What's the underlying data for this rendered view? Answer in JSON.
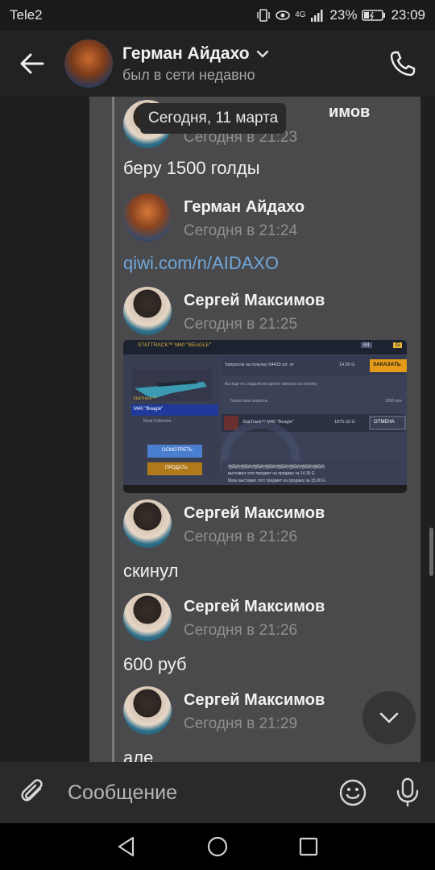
{
  "status_bar": {
    "carrier": "Tele2",
    "signal_label": "4G",
    "battery": "23%",
    "time": "23:09"
  },
  "header": {
    "title": "Герман Айдахо",
    "subtitle": "был в сети недавно"
  },
  "date_tooltip": "Сегодня, 11 марта",
  "messages": [
    {
      "author": "Сергей Максимов",
      "author_visible": "имов",
      "time": "Сегодня в 21:23",
      "text": "беру 1500 голды"
    },
    {
      "author": "Герман Айдахо",
      "time": "Сегодня в 21:24",
      "text": "qiwi.com/n/AIDAXO"
    },
    {
      "author": "Сергей Максимов",
      "time": "Сегодня в 21:25"
    },
    {
      "author": "Сергей Максимов",
      "time": "Сегодня в 21:26",
      "text": "скинул"
    },
    {
      "author": "Сергей Максимов",
      "time": "Сегодня в 21:26",
      "text": "600 руб"
    },
    {
      "author": "Сергей Максимов",
      "time": "Сегодня в 21:29",
      "text": "але"
    }
  ],
  "screenshot": {
    "item_title": "STATTRACK™ M40 \"BEAGLE\"",
    "balance_b": "84",
    "balance_g": "G",
    "requests_label": "Запросов на покупку 64433 шт. от",
    "requests_price": "14.05 G",
    "order_button": "ЗАКАЗАТЬ",
    "no_requests": "Вы еще не создали ни одного запроса на покупку",
    "only_my": "Только мои запросы",
    "count": "1656 пре",
    "statrack": "StatTrack™",
    "item_name": "M40 \"Beagle\"",
    "collection": "Rival Collection",
    "view_button": "ОСМОТРЕТЬ",
    "sell_button": "ПРОДАТЬ",
    "row_item": "StatTrack™ M40 \"Beagle\"",
    "row_price": "1875.02 G",
    "cancel_button": "ОТМЕНА",
    "log_line1": "他妈的他妈的他妈的他妈的他妈的他妈的他妈的他妈的",
    "log_line2": "выставил этот предмет на продажу за 14.30 G",
    "log_line3": "Мазу выставил этот предмет на продажу за 15.00 G"
  },
  "composer": {
    "placeholder": "Сообщение"
  }
}
